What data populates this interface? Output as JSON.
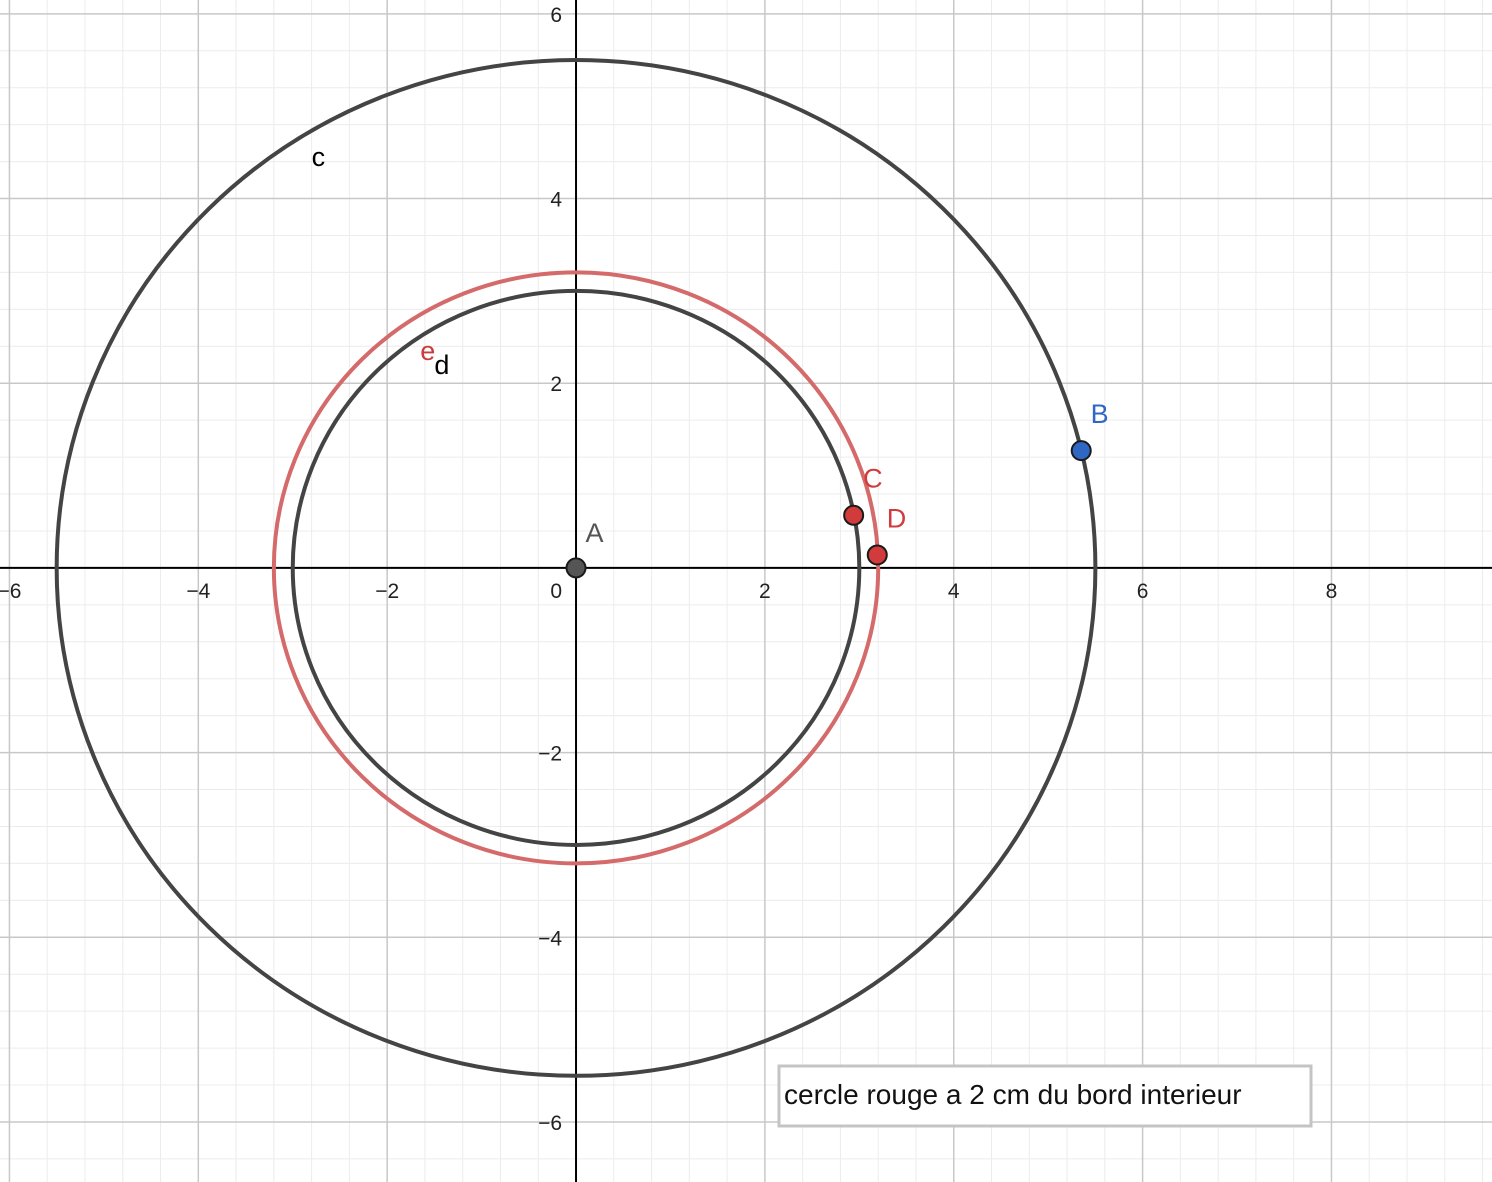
{
  "graph": {
    "x_range": [
      -6.1,
      9.7
    ],
    "y_range": [
      -6.65,
      6.15
    ],
    "major_step": 2,
    "minor_step": 0.4,
    "x_ticks": [
      {
        "v": -6,
        "t": "−6"
      },
      {
        "v": -4,
        "t": "−4"
      },
      {
        "v": -2,
        "t": "−2"
      },
      {
        "v": 0,
        "t": "0"
      },
      {
        "v": 2,
        "t": "2"
      },
      {
        "v": 4,
        "t": "4"
      },
      {
        "v": 6,
        "t": "6"
      },
      {
        "v": 8,
        "t": "8"
      }
    ],
    "y_ticks": [
      {
        "v": 6,
        "t": "6"
      },
      {
        "v": 4,
        "t": "4"
      },
      {
        "v": 2,
        "t": "2"
      },
      {
        "v": -2,
        "t": "−2"
      },
      {
        "v": -4,
        "t": "−4"
      },
      {
        "v": -6,
        "t": "−6"
      }
    ],
    "colors": {
      "grid_major": "#c8c8c8",
      "grid_minor": "#ececec",
      "axis": "#000000",
      "circle_dark": "#444444",
      "circle_red": "#d46a6a",
      "point_red": "#d13b3b",
      "point_blue": "#2f68c4",
      "point_gray": "#555555"
    }
  },
  "circles": [
    {
      "name": "c",
      "label": "c",
      "cx": 0,
      "cy": 0,
      "r": 5.5,
      "color": "#444444",
      "label_x": -2.8,
      "label_y": 4.35,
      "label_color": "#000000"
    },
    {
      "name": "d",
      "label": "d",
      "cx": 0,
      "cy": 0,
      "r": 3,
      "color": "#444444",
      "label_x": -1.5,
      "label_y": 2.1,
      "label_color": "#000000"
    },
    {
      "name": "e",
      "label": "e",
      "cx": 0,
      "cy": 0,
      "r": 3.2,
      "color": "#d46a6a",
      "label_x": -1.65,
      "label_y": 2.25,
      "label_color": "#c83c3c"
    }
  ],
  "points": [
    {
      "name": "A",
      "label": "A",
      "x": 0,
      "y": 0,
      "fill": "#555555",
      "label_color": "#555555",
      "label_dx": 0.1,
      "label_dy": 0.28
    },
    {
      "name": "B",
      "label": "B",
      "x": 5.35,
      "y": 1.27,
      "fill": "#2f68c4",
      "label_color": "#2f68c4",
      "label_dx": 0.1,
      "label_dy": 0.3
    },
    {
      "name": "C",
      "label": "C",
      "x": 2.94,
      "y": 0.57,
      "fill": "#d13b3b",
      "label_color": "#d13b3b",
      "label_dx": 0.1,
      "label_dy": 0.3
    },
    {
      "name": "D",
      "label": "D",
      "x": 3.19,
      "y": 0.14,
      "fill": "#d13b3b",
      "label_color": "#d13b3b",
      "label_dx": 0.1,
      "label_dy": 0.3
    }
  ],
  "note": {
    "text": "cercle rouge a 2 cm du bord interieur"
  }
}
